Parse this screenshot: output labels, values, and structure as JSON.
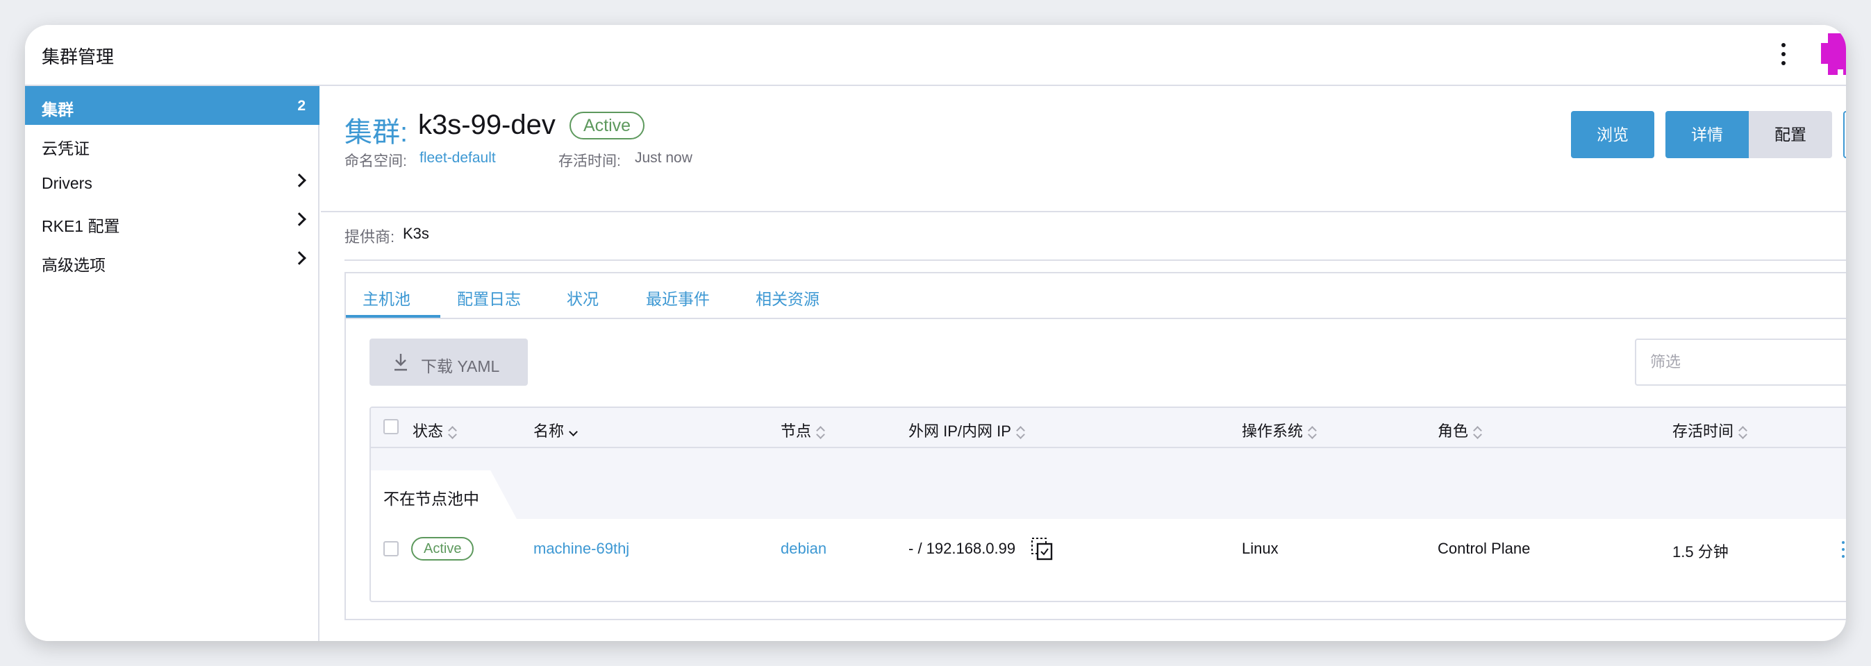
{
  "header": {
    "title": "集群管理",
    "menu_icon": "more-vertical-icon",
    "brand_icon": "brand-logo-icon",
    "brand_color": "#d61ad3"
  },
  "sidebar": {
    "items": [
      {
        "label": "集群",
        "count": "2",
        "active": true
      },
      {
        "label": "云凭证"
      },
      {
        "label": "Drivers",
        "expandable": true
      },
      {
        "label": "RKE1 配置",
        "expandable": true
      },
      {
        "label": "高级选项",
        "expandable": true
      }
    ]
  },
  "cluster": {
    "title_prefix": "集群:",
    "name": "k3s-99-dev",
    "status": "Active",
    "namespace_label": "命名空间:",
    "namespace": "fleet-default",
    "age_label": "存活时间:",
    "age": "Just now",
    "provider_label": "提供商:",
    "provider": "K3s"
  },
  "actions": {
    "browse": "浏览",
    "detail": "详情",
    "config": "配置"
  },
  "tabs": [
    "主机池",
    "配置日志",
    "状况",
    "最近事件",
    "相关资源"
  ],
  "toolbar": {
    "download": "下载 YAML",
    "filter_placeholder": "筛选"
  },
  "table": {
    "headers": [
      "状态",
      "名称",
      "节点",
      "外网 IP/内网 IP",
      "操作系统",
      "角色",
      "存活时间"
    ],
    "group_label": "不在节点池中",
    "rows": [
      {
        "status": "Active",
        "name": "machine-69thj",
        "node": "debian",
        "ip": "- / 192.168.0.99",
        "os": "Linux",
        "role": "Control Plane",
        "age": "1.5 分钟"
      }
    ]
  },
  "colors": {
    "accent": "#3d98d3",
    "success": "#5d995d",
    "border": "#dcdee7"
  }
}
